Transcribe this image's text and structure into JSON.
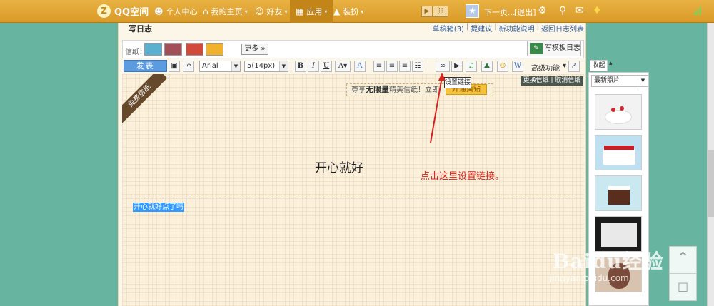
{
  "topbar": {
    "brand": "QQ空间",
    "logo_letter": "Z",
    "nav": [
      {
        "label": "个人中心",
        "icon": "person-icon"
      },
      {
        "label": "我的主页",
        "icon": "home-icon"
      },
      {
        "label": "好友",
        "icon": "friends-icon"
      },
      {
        "label": "应用",
        "icon": "apps-icon"
      },
      {
        "label": "装扮",
        "icon": "shirt-icon"
      }
    ],
    "next_page": "下一页...",
    "logout": "[退出]",
    "accent": "#d99a28",
    "active_color": "#c38518"
  },
  "editor_page": {
    "title": "写日志",
    "links": [
      "草稿箱(3)",
      "提建议",
      "新功能说明",
      "返回日志列表"
    ]
  },
  "paper_row": {
    "label": "信纸：",
    "more_button": "更多 »",
    "template_button": "写模板日志"
  },
  "toolbar": {
    "publish_button": "发表",
    "font_family": "Arial",
    "font_size": "5(14px)",
    "bold": "B",
    "italic": "I",
    "underline": "U",
    "advanced": "高级功能",
    "link_tooltip": "设置链接",
    "paper_actions": "更换信纸 | 取消信纸"
  },
  "editor": {
    "ribbon": "免费信纸",
    "promo_text_prefix": "尊享",
    "promo_bold": "无限量",
    "promo_text_suffix": "精美信纸！立即",
    "promo_button": "开通黄钻",
    "doc_title": "开心就好",
    "selected_text": "开心就好点了吗",
    "annotation": "点击这里设置链接。",
    "annotation_color": "#d6231e"
  },
  "sidebar": {
    "tab": "收起",
    "select_label": "最新照片"
  },
  "watermark": {
    "text": "Baidu经验",
    "url": "jingyan.baidu.com"
  }
}
